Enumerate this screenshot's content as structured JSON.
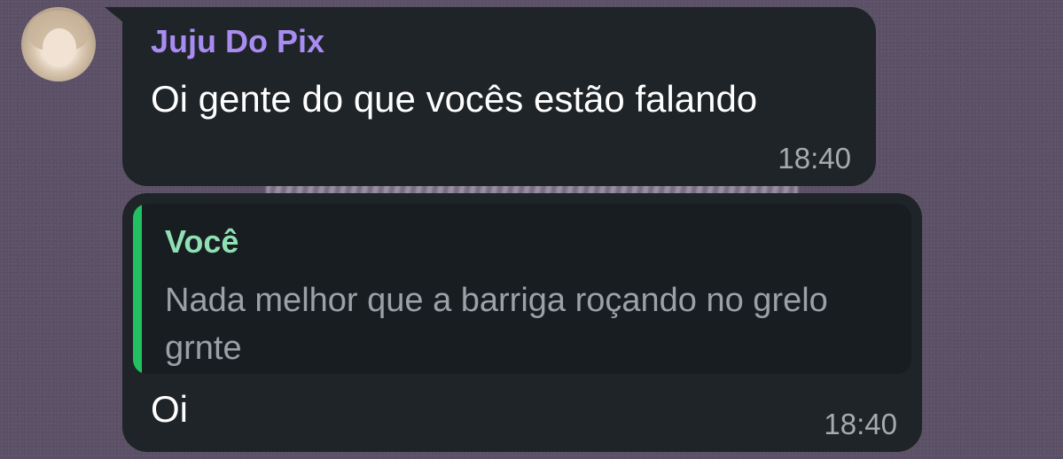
{
  "messages": [
    {
      "sender": "Juju Do Pix",
      "text": "Oi gente do que vocês estão falando",
      "time": "18:40"
    },
    {
      "reply_to": {
        "author": "Você",
        "text": "Nada melhor que a barriga roçando no grelo grnte"
      },
      "text": "Oi",
      "time": "18:40"
    }
  ],
  "colors": {
    "bubble": "#1f2428",
    "sender_name": "#a98cf2",
    "quote_author": "#8fe0b3",
    "quote_bar": "#21c063",
    "timestamp": "#a7abb0"
  },
  "icons": {
    "avatar": "contact-avatar"
  }
}
